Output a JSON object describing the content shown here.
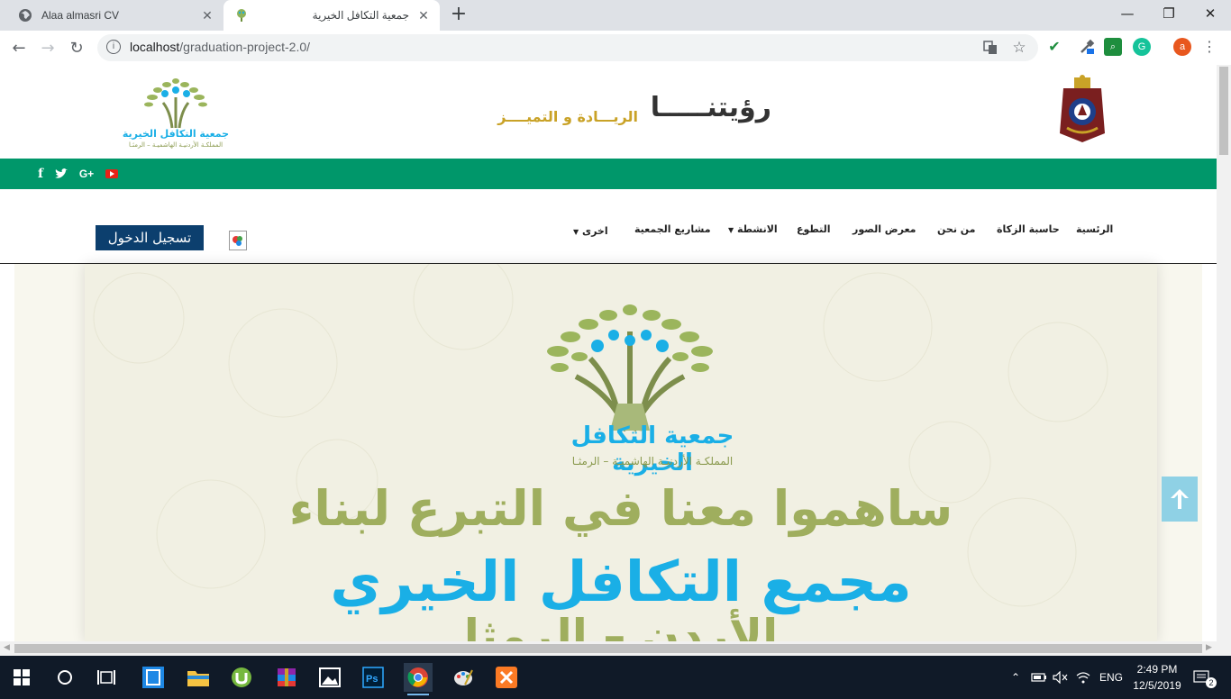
{
  "browser": {
    "tabs": [
      {
        "title": "Alaa almasri CV",
        "icon": "globe-icon"
      },
      {
        "title": "جمعية التكافل الخيرية",
        "icon": "tree-favicon"
      }
    ],
    "url_host": "localhost",
    "url_path": "/graduation-project-2.0/",
    "profile_initial": "a"
  },
  "header": {
    "vision_title": "رؤيتنـــــا",
    "vision_subtitle": "الريـــادة و التميــــز",
    "logo_name": "جمعية التكافل الخيرية",
    "logo_sub": "المملكـة الأردنيـة الهاشميـة – الرمثـا"
  },
  "social": {
    "facebook": "f",
    "twitter": "twitter-icon",
    "google": "G+",
    "youtube": "youtube-icon"
  },
  "nav": {
    "login": "تسجيل الدخول",
    "items": [
      "الرئسية",
      "حاسبة الزكاة",
      "من نحن",
      "معرض الصور",
      "التطوع",
      "الانشطة",
      "مشاريع الجمعية",
      "اخرى"
    ]
  },
  "banner": {
    "logo_name": "جمعية التكافل الخيرية",
    "logo_sub": "المملكـة الأردنيـة الهاشميـة – الرمثـا",
    "line1": "ساهموا معنا في التبرع لبناء",
    "line2": "مجمع التكافل الخيري",
    "line3": "الأردن – الرمثا"
  },
  "taskbar": {
    "time": "2:49 PM",
    "date": "12/5/2019",
    "language": "ENG",
    "notifications": "2"
  },
  "colors": {
    "green_bar": "#00976a",
    "login_button": "#0c3f6e",
    "banner_blue": "#1aafe6",
    "banner_olive": "#9fae5e"
  }
}
